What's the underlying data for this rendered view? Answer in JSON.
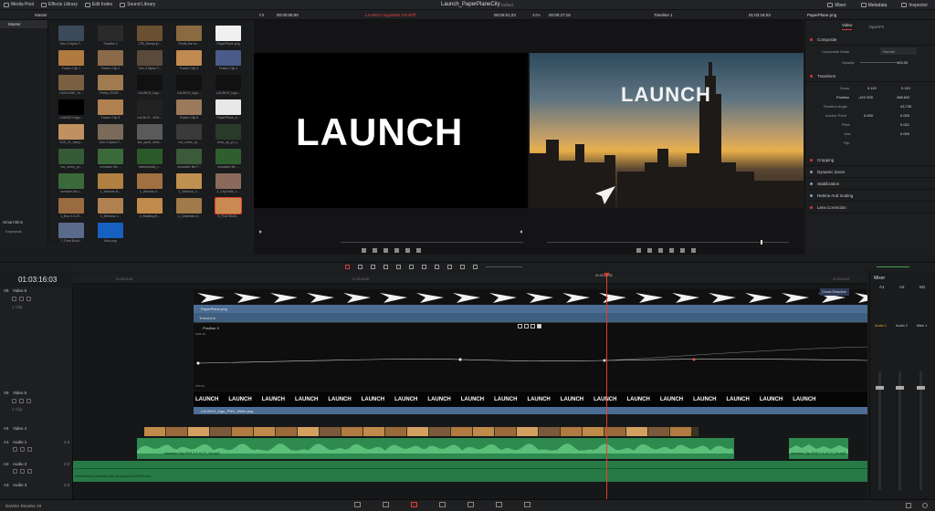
{
  "topbar": {
    "tabs": [
      "Media Pool",
      "Effects Library",
      "Edit Index",
      "Sound Library"
    ],
    "project_title": "Launch_PaperPlaneCity",
    "project_state": "Edited",
    "right_tabs": [
      "Mixer",
      "Metadata",
      "Inspector"
    ]
  },
  "bar2": {
    "bin_name": "Master",
    "source_fit": "Fit",
    "source_tc": "00:00:05:00",
    "source_clip": "LAUNCH logoMark TohnDff",
    "source_tc2": "00:00:01:23",
    "zoom": "43%",
    "timeline_dur": "00:00:27:15",
    "timeline_name": "Timeline 1",
    "timeline_tc": "01:03:16:03",
    "inspector_clip": "PaperPlane.png"
  },
  "media_pool": {
    "left_items": [
      "Master"
    ],
    "smart_bins": "Smart Bins",
    "keywords": "Keywords",
    "clips": [
      {
        "label": "Gen-3 Alpha T...",
        "color": "#3a4a5a"
      },
      {
        "label": "Timeline 1",
        "color": "#2a2a2a"
      },
      {
        "label": "LTB_Stmrpl.ip...",
        "color": "#6a5030"
      },
      {
        "label": "Firefly the im...",
        "color": "#8a6a40"
      },
      {
        "label": "PaperPlane.png",
        "color": "#f0f0f0"
      },
      {
        "label": "Fusion Clip 1",
        "color": "#b07a40"
      },
      {
        "label": "Fusion Clip 2",
        "color": "#8a6a48"
      },
      {
        "label": "Gen-3 Alpha T...",
        "color": "#5a4a3a"
      },
      {
        "label": "Fusion Clip 3",
        "color": "#c08a50"
      },
      {
        "label": "Fusion Clip 4",
        "color": "#4a5a8a"
      },
      {
        "label": "1920x1080_Yo...",
        "color": "#7a6040"
      },
      {
        "label": "Firefly 2020E...",
        "color": "#a07a50"
      },
      {
        "label": "LAUNCH_logo...",
        "color": "#111111"
      },
      {
        "label": "LAUNCH_logo...",
        "color": "#111111"
      },
      {
        "label": "LAUNCH_logo...",
        "color": "#111111"
      },
      {
        "label": "LAUNCH logo...",
        "color": "#000000"
      },
      {
        "label": "Fusion Clip 5",
        "color": "#b08050"
      },
      {
        "label": "LAUNCH - MOL...",
        "color": "#222222"
      },
      {
        "label": "Fusion Clip 6",
        "color": "#9a7a5a"
      },
      {
        "label": "PaperPlane_fr...",
        "color": "#e8e8e8"
      },
      {
        "label": "DJS_01_Navy...",
        "color": "#c09060"
      },
      {
        "label": "Gen-3 Alpha T...",
        "color": "#7a6a5a"
      },
      {
        "label": "ars_sport_whtd...",
        "color": "#5a5a5a"
      },
      {
        "label": "ms_crmrc_pl...",
        "color": "#3a3a3a"
      },
      {
        "label": "crew_up_pl_c...",
        "color": "#2a3a2a"
      },
      {
        "label": "ms_crmrc_pl...",
        "color": "#355a35"
      },
      {
        "label": "mrmaker file ...",
        "color": "#3a6a3a"
      },
      {
        "label": "mtcinematcl_r...",
        "color": "#2a5a2a"
      },
      {
        "label": "mmacker file F...",
        "color": "#3a5a3a"
      },
      {
        "label": "mmacker file ...",
        "color": "#2f5f2f"
      },
      {
        "label": "mmaker-file-l...",
        "color": "#3a6a3a"
      },
      {
        "label": "1_Window B...",
        "color": "#b08040"
      },
      {
        "label": "1_Window 3...",
        "color": "#a07040"
      },
      {
        "label": "1_Window_2...",
        "color": "#c09050"
      },
      {
        "label": "3_CityTrails_1...",
        "color": "#8a6a5a"
      },
      {
        "label": "1_Bus 3.0-20...",
        "color": "#9a6a40"
      },
      {
        "label": "1_Window 1...",
        "color": "#b08050"
      },
      {
        "label": "4_Building B...",
        "color": "#c08a4a"
      },
      {
        "label": "1_Cinematic 5...",
        "color": "#a07a4a"
      },
      {
        "label": "6_Final Build...",
        "color": "#c88a50"
      },
      {
        "label": "7_Final Build...",
        "color": "#5a6a8a"
      },
      {
        "label": "blue.png",
        "color": "#1560c0"
      }
    ]
  },
  "viewer1": {
    "logo_text": "LAUNCH"
  },
  "viewer2": {
    "logo_text": "LAUNCH"
  },
  "inspector": {
    "tabs": [
      "Video",
      "OpenFX"
    ],
    "sections": {
      "composite": "Composite",
      "composite_mode_label": "Composite Mode",
      "composite_mode_value": "Normal",
      "opacity_label": "Opacity",
      "opacity_value": "100.00",
      "transform": "Transform",
      "zoom_label": "Zoom",
      "zoom_x": "0.119",
      "zoom_y": "0.119",
      "position_label": "Position",
      "pos_x": "-422.335",
      "pos_y": "288.632",
      "rotation_label": "Rotation Angle",
      "rotation_value": "43.730",
      "anchor_label": "Anchor Point",
      "anchor_x": "0.000",
      "anchor_y": "0.000",
      "pitch_label": "Pitch",
      "pitch_value": "0.021",
      "yaw_label": "Yaw",
      "yaw_value": "0.000",
      "flip_label": "Flip",
      "cropping": "Cropping",
      "dynamic_zoom": "Dynamic Zoom",
      "stabilization": "Stabilization",
      "retime": "Retime And Scaling",
      "lens": "Lens Correction"
    }
  },
  "timeline": {
    "timecode": "01:03:16:03",
    "ruler": [
      "01:03:15:00",
      "01:03:16:00",
      "01:03:16:03",
      "01:03:16:12"
    ],
    "tracks": [
      {
        "id": "V6",
        "name": "Video 6",
        "clips": "1 Clip"
      },
      {
        "id": "V5",
        "name": "Video 5",
        "clips": "1 Clip"
      },
      {
        "id": "V4",
        "name": "Video 4",
        "clips": ""
      },
      {
        "id": "A1",
        "name": "Audio 1",
        "level": "2.0"
      },
      {
        "id": "A2",
        "name": "Audio 2",
        "level": "2.0"
      },
      {
        "id": "A3",
        "name": "Audio 3",
        "level": "2.0"
      }
    ],
    "clip_v6": "PaperPlane.png",
    "clip_v6_transform": "Transform",
    "clip_v6_position": "Position X",
    "clip_v6_fx": "Cross Dissolve",
    "clip_v5": "LAUNCH_logo_PNG_White.png",
    "clip_a1": "Hamaker-Clip 2025-2-3 14:17_1st.mp3",
    "clip_a1b": "Hamaker-Clip 2025-2-3 14:17_1st.mp3",
    "clip_a2": "motherdrash-cinematic-epic-background-305198.mp3",
    "range_max": "max.xx",
    "range_min": "min.xx"
  },
  "mixer": {
    "title": "Mixer",
    "channels": [
      "A1",
      "A2",
      "M1"
    ],
    "names": [
      "Audio 1",
      "Audio 2",
      "Main 1"
    ]
  },
  "bottombar": {
    "app": "DaVinci Resolve 19"
  }
}
